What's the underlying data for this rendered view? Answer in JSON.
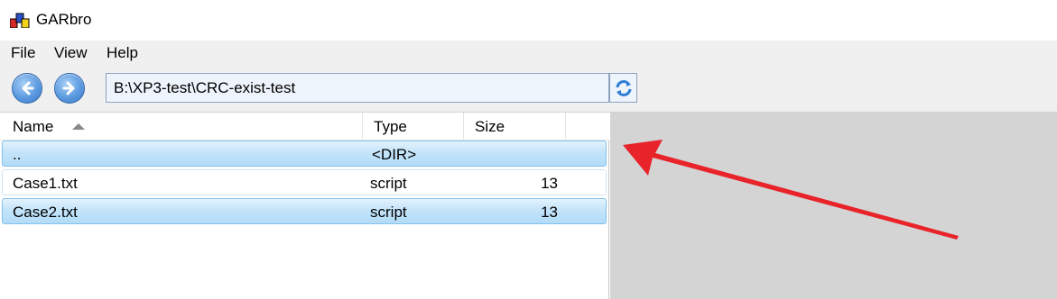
{
  "window": {
    "title": "GARbro"
  },
  "menu": {
    "items": [
      "File",
      "View",
      "Help"
    ]
  },
  "toolbar": {
    "path": "B:\\XP3-test\\CRC-exist-test"
  },
  "table": {
    "columns": [
      "Name",
      "Type",
      "Size"
    ],
    "sorted_by": "Name",
    "rows": [
      {
        "name": "..",
        "type": "<DIR>",
        "size": "",
        "selected": true
      },
      {
        "name": "Case1.txt",
        "type": "script",
        "size": "13",
        "selected": false
      },
      {
        "name": "Case2.txt",
        "type": "script",
        "size": "13",
        "selected": true
      }
    ]
  },
  "colors": {
    "annotation_arrow": "#e8232a",
    "selection": "#c4e4fa",
    "side_pane": "#d4d4d4"
  },
  "icons": {
    "back": "arrow-left-circle-icon",
    "forward": "arrow-right-circle-icon",
    "refresh": "refresh-icon",
    "app": "garbro-app-icon",
    "sort": "sort-ascending-icon"
  }
}
